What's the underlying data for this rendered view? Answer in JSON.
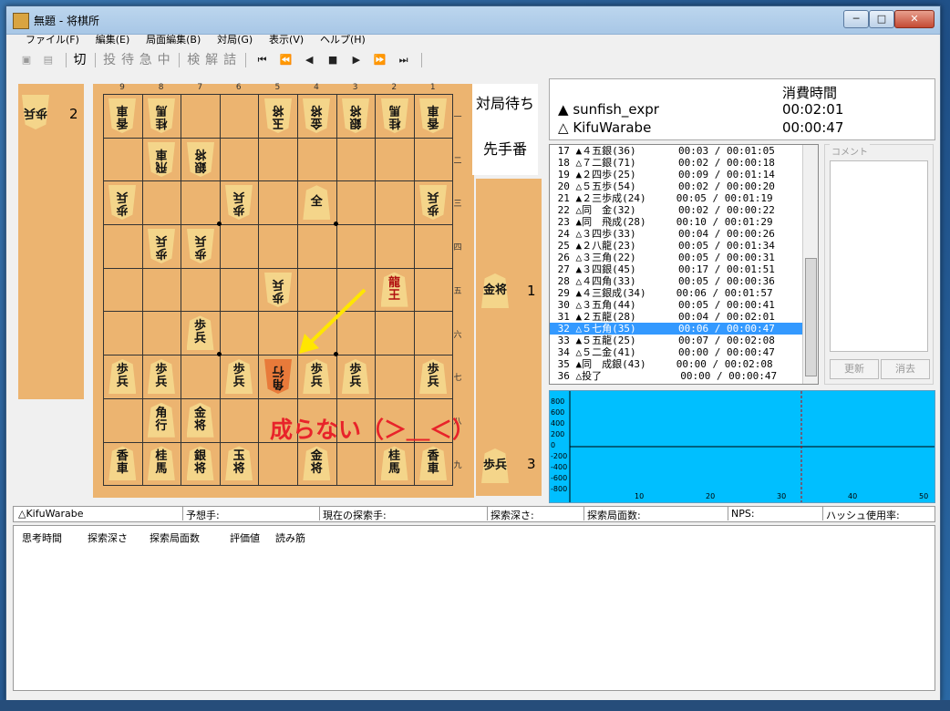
{
  "window": {
    "title": "無題 - 将棋所",
    "min": "─",
    "max": "□",
    "close": "✕"
  },
  "menu": [
    "ファイル(F)",
    "編集(E)",
    "局面編集(B)",
    "対局(G)",
    "表示(V)",
    "ヘルプ(H)"
  ],
  "toolbar": {
    "save_icon": "save-icon",
    "load_icon": "load-icon",
    "actions": [
      "切",
      "投",
      "待",
      "急",
      "中",
      "検",
      "解",
      "詰"
    ],
    "nav": [
      "⏮",
      "⏪",
      "◀",
      "■",
      "▶",
      "⏩",
      "⏭"
    ]
  },
  "board": {
    "col_labels": [
      "9",
      "8",
      "7",
      "6",
      "5",
      "4",
      "3",
      "2",
      "1"
    ],
    "row_labels": [
      "一",
      "二",
      "三",
      "四",
      "五",
      "六",
      "七",
      "八",
      "九"
    ]
  },
  "pieces": [
    {
      "text": "香車",
      "owner": "gote",
      "c": 0,
      "r": 0
    },
    {
      "text": "桂馬",
      "owner": "gote",
      "c": 1,
      "r": 0
    },
    {
      "text": "玉将",
      "owner": "gote",
      "c": 4,
      "r": 0
    },
    {
      "text": "金将",
      "owner": "gote",
      "c": 5,
      "r": 0
    },
    {
      "text": "銀将",
      "owner": "gote",
      "c": 6,
      "r": 0
    },
    {
      "text": "桂馬",
      "owner": "gote",
      "c": 7,
      "r": 0
    },
    {
      "text": "香車",
      "owner": "gote",
      "c": 8,
      "r": 0
    },
    {
      "text": "飛車",
      "owner": "gote",
      "c": 1,
      "r": 1
    },
    {
      "text": "銀将",
      "owner": "gote",
      "c": 2,
      "r": 1
    },
    {
      "text": "歩兵",
      "owner": "gote",
      "c": 0,
      "r": 2
    },
    {
      "text": "歩兵",
      "owner": "gote",
      "c": 3,
      "r": 2
    },
    {
      "text": "全",
      "owner": "gote",
      "c": 5,
      "r": 2,
      "upright": true
    },
    {
      "text": "歩兵",
      "owner": "gote",
      "c": 8,
      "r": 2
    },
    {
      "text": "歩兵",
      "owner": "gote",
      "c": 1,
      "r": 3
    },
    {
      "text": "歩兵",
      "owner": "gote",
      "c": 2,
      "r": 3
    },
    {
      "text": "歩兵",
      "owner": "gote",
      "c": 4,
      "r": 4
    },
    {
      "text": "龍王",
      "owner": "sente",
      "c": 7,
      "r": 4,
      "promoted": true
    },
    {
      "text": "歩兵",
      "owner": "sente",
      "c": 2,
      "r": 5
    },
    {
      "text": "歩兵",
      "owner": "sente",
      "c": 0,
      "r": 6
    },
    {
      "text": "歩兵",
      "owner": "sente",
      "c": 1,
      "r": 6
    },
    {
      "text": "歩兵",
      "owner": "sente",
      "c": 3,
      "r": 6
    },
    {
      "text": "角行",
      "owner": "gote",
      "c": 4,
      "r": 6,
      "sel": true
    },
    {
      "text": "歩兵",
      "owner": "sente",
      "c": 5,
      "r": 6
    },
    {
      "text": "歩兵",
      "owner": "sente",
      "c": 6,
      "r": 6
    },
    {
      "text": "歩兵",
      "owner": "sente",
      "c": 8,
      "r": 6
    },
    {
      "text": "角行",
      "owner": "sente",
      "c": 1,
      "r": 7
    },
    {
      "text": "金将",
      "owner": "sente",
      "c": 2,
      "r": 7
    },
    {
      "text": "香車",
      "owner": "sente",
      "c": 0,
      "r": 8
    },
    {
      "text": "桂馬",
      "owner": "sente",
      "c": 1,
      "r": 8
    },
    {
      "text": "銀将",
      "owner": "sente",
      "c": 2,
      "r": 8
    },
    {
      "text": "玉将",
      "owner": "sente",
      "c": 3,
      "r": 8
    },
    {
      "text": "金将",
      "owner": "sente",
      "c": 5,
      "r": 8
    },
    {
      "text": "桂馬",
      "owner": "sente",
      "c": 7,
      "r": 8
    },
    {
      "text": "香車",
      "owner": "sente",
      "c": 8,
      "r": 8
    }
  ],
  "hands": {
    "gote": {
      "piece": "歩兵",
      "count": "2"
    },
    "sente": [
      {
        "piece": "金将",
        "count": "1"
      },
      {
        "piece": "歩兵",
        "count": "3"
      }
    ]
  },
  "status": {
    "wait": "対局待ち",
    "turn": "先手番"
  },
  "annotation": "成らない（＞＿＜）",
  "clock": {
    "header": "消費時間",
    "players": [
      {
        "mark": "▲",
        "name": "sunfish_expr",
        "time": "00:02:01"
      },
      {
        "mark": "△",
        "name": "KifuWarabe",
        "time": "00:00:47"
      }
    ]
  },
  "moves": [
    {
      "text": " 17 ▲４五銀(36)       00:03 / 00:01:05"
    },
    {
      "text": " 18 △７二銀(71)       00:02 / 00:00:18"
    },
    {
      "text": " 19 ▲２四歩(25)       00:09 / 00:01:14"
    },
    {
      "text": " 20 △５五歩(54)       00:02 / 00:00:20"
    },
    {
      "text": " 21 ▲２三歩成(24)     00:05 / 00:01:19"
    },
    {
      "text": " 22 △同　金(32)       00:02 / 00:00:22"
    },
    {
      "text": " 23 ▲同　飛成(28)     00:10 / 00:01:29"
    },
    {
      "text": " 24 △３四歩(33)       00:04 / 00:00:26"
    },
    {
      "text": " 25 ▲２八龍(23)       00:05 / 00:01:34"
    },
    {
      "text": " 26 △３三角(22)       00:05 / 00:00:31"
    },
    {
      "text": " 27 ▲３四銀(45)       00:17 / 00:01:51"
    },
    {
      "text": " 28 △４四角(33)       00:05 / 00:00:36"
    },
    {
      "text": " 29 ▲４三銀成(34)     00:06 / 00:01:57"
    },
    {
      "text": " 30 △３五角(44)       00:05 / 00:00:41"
    },
    {
      "text": " 31 ▲２五龍(28)       00:04 / 00:02:01"
    },
    {
      "text": " 32 △５七角(35)       00:06 / 00:00:47",
      "sel": true
    },
    {
      "text": " 33 ▲５五龍(25)       00:07 / 00:02:08"
    },
    {
      "text": " 34 △５二金(41)       00:00 / 00:00:47"
    },
    {
      "text": " 35 ▲同　成銀(43)     00:00 / 00:02:08"
    },
    {
      "text": " 36 △投了             00:00 / 00:00:47"
    }
  ],
  "comment": {
    "label": "コメント",
    "update": "更新",
    "clear": "消去"
  },
  "graph": {
    "y_labels": [
      "800",
      "600",
      "400",
      "200",
      "0",
      "-200",
      "-400",
      "-600",
      "-800"
    ],
    "x_labels": [
      "10",
      "20",
      "30",
      "40",
      "50"
    ],
    "bg": "#00bfff"
  },
  "info": [
    "△KifuWarabe",
    "予想手:",
    "現在の探索手:",
    "探索深さ:",
    "探索局面数:",
    "NPS:",
    "ハッシュ使用率:"
  ],
  "engine_headers": [
    "思考時間",
    "探索深さ",
    "探索局面数",
    "評価値",
    "読み筋"
  ]
}
